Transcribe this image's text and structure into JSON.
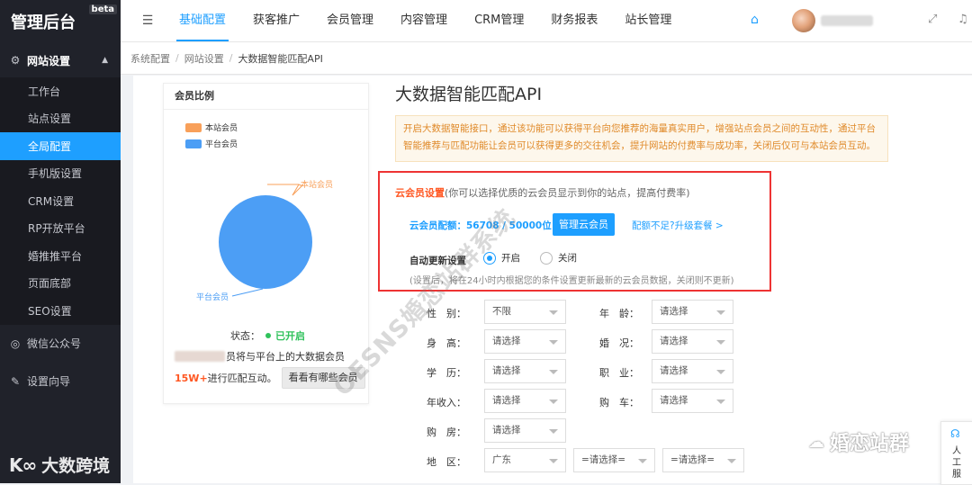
{
  "sidebar": {
    "logo": "管理后台",
    "badge": "beta",
    "group_label": "网站设置",
    "items": [
      "工作台",
      "站点设置",
      "全局配置",
      "手机版设置",
      "CRM设置",
      "RP开放平台",
      "婚推推平台",
      "页面底部",
      "SEO设置"
    ],
    "active_index": 2,
    "extra": [
      "微信公众号",
      "设置向导"
    ]
  },
  "watermarks": {
    "bottom_left": "大数跨境",
    "bottom_left_mark": "K∞",
    "diagonal": "OESNS婚恋站群系统",
    "bottom_right": "婚恋站群"
  },
  "topbar": {
    "tabs": [
      "基础配置",
      "获客推广",
      "会员管理",
      "内容管理",
      "CRM管理",
      "财务报表",
      "站长管理"
    ],
    "active_tab": 0
  },
  "breadcrumb": [
    "系统配置",
    "网站设置",
    "大数据智能匹配API"
  ],
  "left_card": {
    "title": "会员比例",
    "legend": [
      {
        "name": "本站会员",
        "color": "#f8a05a"
      },
      {
        "name": "平台会员",
        "color": "#4c9ef5"
      }
    ],
    "pie_labels": [
      "本站会员",
      "平台会员"
    ],
    "status_label": "状态：",
    "status_value": "已开启",
    "note_line1_suffix": "员将与平台上的大数据会员",
    "note_highlight": "15W+",
    "note_line2": "进行匹配互动。",
    "view_button": "看看有哪些会员"
  },
  "content": {
    "title": "大数据智能匹配API",
    "notice": "开启大数据智能接口，通过该功能可以获得平台向您推荐的海量真实用户，增强站点会员之间的互动性，通过平台智能推荐与匹配功能让会员可以获得更多的交往机会，提升网站的付费率与成功率，关闭后仅可与本站会员互动。",
    "cloud_title": "云会员设置",
    "cloud_desc": "(你可以选择优质的云会员显示到你的站点，提高付费率)",
    "quota": "云会员配额：56708 / 50000位",
    "manage_button": "管理云会员",
    "upgrade_link": "配额不足?升级套餐 >",
    "auto_update_label": "自动更新设置",
    "radio_on": "开启",
    "radio_off": "关闭",
    "hint": "(设置后，将在24小时内根据您的条件设置更新最新的云会员数据，关闭则不更新)"
  },
  "filters": {
    "gender_label": "性　别：",
    "gender_value": "不限",
    "age_label": "年　龄：",
    "age_value": "请选择",
    "height_label": "身　高：",
    "height_value": "请选择",
    "marriage_label": "婚　况：",
    "marriage_value": "请选择",
    "edu_label": "学　历：",
    "edu_value": "请选择",
    "job_label": "职　业：",
    "job_value": "请选择",
    "income_label": "年收入：",
    "income_value": "请选择",
    "car_label": "购　车：",
    "car_value": "请选择",
    "house_label": "购　房：",
    "house_value": "请选择",
    "region_label": "地　区：",
    "region_value": "广东",
    "city_value": "=请选择=",
    "district_value": "=请选择="
  },
  "service": {
    "label": "人工服"
  }
}
